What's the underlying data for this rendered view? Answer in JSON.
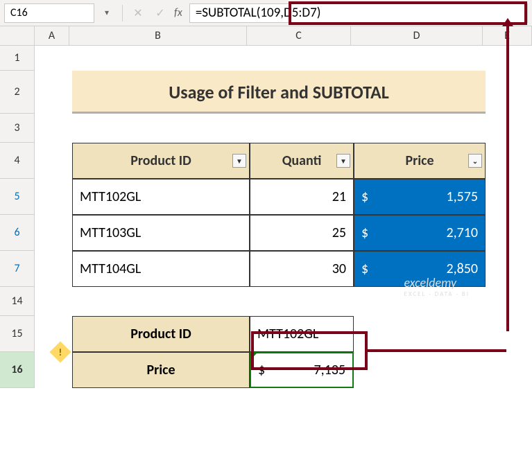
{
  "namebox": {
    "value": "C16"
  },
  "formula_bar": {
    "cancel_icon": "✕",
    "confirm_icon": "✓",
    "fx_label": "fx",
    "formula": "=SUBTOTAL(109,D5:D7)"
  },
  "columns": [
    "A",
    "B",
    "C",
    "D",
    "E"
  ],
  "rows": [
    "1",
    "2",
    "3",
    "4",
    "5",
    "6",
    "7",
    "14",
    "15",
    "16"
  ],
  "title": "Usage of Filter and SUBTOTAL",
  "table": {
    "headers": {
      "product_id": "Product ID",
      "quantity": "Quanti",
      "price": "Price"
    },
    "filter_glyph": "▼",
    "filter_active_glyph": "⌄",
    "rows": [
      {
        "product_id": "MTT102GL",
        "quantity": "21",
        "price_sym": "$",
        "price_val": "1,575"
      },
      {
        "product_id": "MTT103GL",
        "quantity": "25",
        "price_sym": "$",
        "price_val": "2,710"
      },
      {
        "product_id": "MTT104GL",
        "quantity": "30",
        "price_sym": "$",
        "price_val": "2,850"
      }
    ]
  },
  "result": {
    "label_pid": "Product ID",
    "value_pid": "MTT102GL",
    "label_price": "Price",
    "price_sym": "$",
    "price_val": "7,135",
    "error_glyph": "!"
  },
  "watermark": {
    "brand": "exceldemy",
    "tagline": "EXCEL · DATA · BI"
  }
}
